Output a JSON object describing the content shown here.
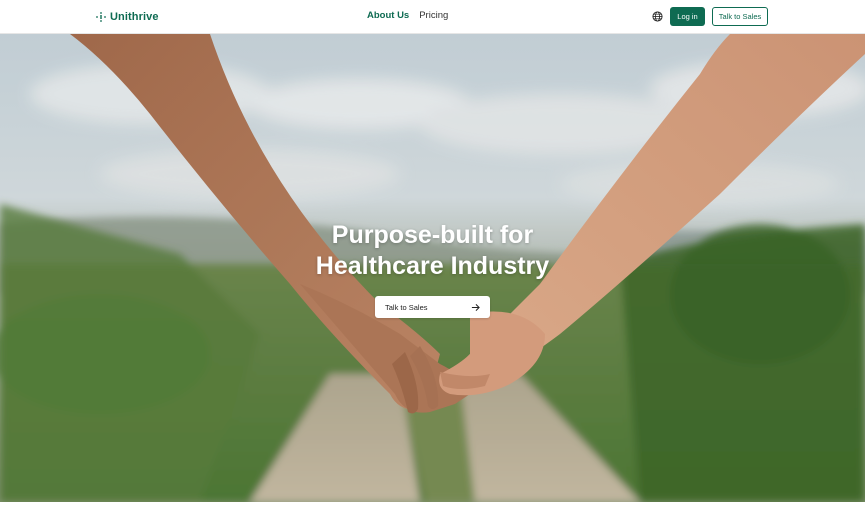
{
  "brand": {
    "name": "Unithrive",
    "accent": "#0e6b52"
  },
  "nav": {
    "links": [
      {
        "label": "About Us",
        "active": true
      },
      {
        "label": "Pricing",
        "active": false
      }
    ],
    "globe_icon": "globe-icon",
    "login_label": "Log in",
    "sales_label": "Talk to Sales"
  },
  "hero": {
    "title_line1": "Purpose-built for",
    "title_line2": "Healthcare Industry",
    "cta_label": "Talk to Sales",
    "cta_icon": "arrow-right-icon",
    "image": "two-hands-holding-on-country-path"
  }
}
